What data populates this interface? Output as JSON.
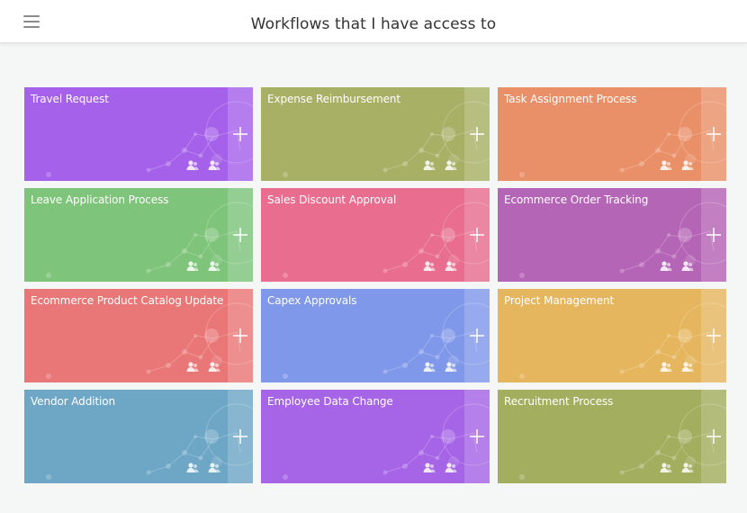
{
  "header": {
    "title": "Workflows that I have access to",
    "menu_icon": "hamburger-menu-icon"
  },
  "workflows": [
    {
      "title": "Travel Request",
      "color": "#a561e9"
    },
    {
      "title": "Expense Reimbursement",
      "color": "#a7b065"
    },
    {
      "title": "Task Assignment Process",
      "color": "#ea9068"
    },
    {
      "title": "Leave Application Process",
      "color": "#7ec47a"
    },
    {
      "title": "Sales Discount Approval",
      "color": "#e86d8f"
    },
    {
      "title": "Ecommerce Order Tracking",
      "color": "#b565b5"
    },
    {
      "title": "Ecommerce Product Catalog Update",
      "color": "#ea7777"
    },
    {
      "title": "Capex Approvals",
      "color": "#8098e9"
    },
    {
      "title": "Project Management",
      "color": "#e5b65e"
    },
    {
      "title": "Vendor Addition",
      "color": "#6ea7c6"
    },
    {
      "title": "Employee Data Change",
      "color": "#a664e6"
    },
    {
      "title": "Recruitment Process",
      "color": "#a3ae5f"
    }
  ],
  "icons": {
    "add": "plus-icon",
    "users": "users-icon"
  }
}
